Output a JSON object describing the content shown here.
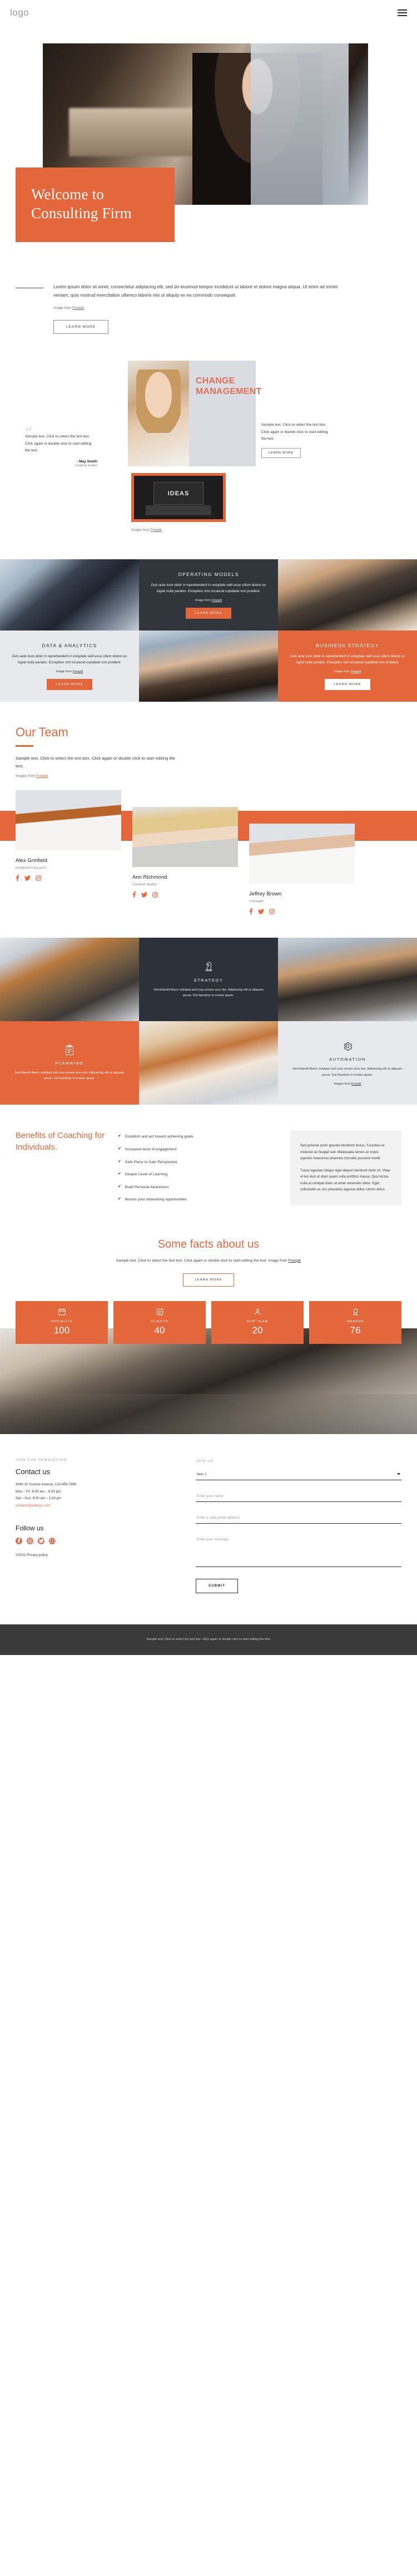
{
  "header": {
    "logo": "logo",
    "menu_icon": "hamburger-icon"
  },
  "hero": {
    "title_line1": "Welcome to",
    "title_line2": "Consulting Firm",
    "paragraph": "Lorem ipsum dolor sit amet, consectetur adipiscing elit, sed do eiusmod tempor incididunt ut labore et dolore magna aliqua. Ut enim ad minim veniam, quis nostrud exercitation ullamco laboris nisi ut aliquip ex ea commodo consequat.",
    "credit_prefix": "Image from ",
    "credit_link": "Freepik",
    "cta": "LEARN MORE"
  },
  "change": {
    "title_line1": "CHANGE",
    "title_line2": "MANAGEMENT",
    "right_text": "Sample text. Click to select the text box. Click again or double click to start editing the text.",
    "right_cta": "LEARN MORE",
    "quote_text": "Sample text. Click to select the text box. Click again or double click to start editing the text.",
    "quote_author": "- May Smith",
    "quote_role": "creative leader",
    "ideas_word": "IDEAS",
    "credit_prefix": "Images from ",
    "credit_link": "Freepik"
  },
  "services": [
    {
      "kind": "photo",
      "name": "two-businessmen-photo"
    },
    {
      "kind": "dark",
      "title": "OPERATING MODELS",
      "text": "Duis aute irure dolor in reprehenderit in voluptate velit esse cillum dolore eu fugiat nulla pariatur. Excepteur sint occaecat cupidatat non proident.",
      "credit_prefix": "Image from ",
      "credit_link": "Freepik",
      "cta": "LEARN MORE"
    },
    {
      "kind": "photo",
      "name": "smiling-man-coffee-photo"
    },
    {
      "kind": "light",
      "title": "DATA & ANALYTICS",
      "text": "Duis aute irure dolor in reprehenderit in voluptate velit esse cillum dolore eu fugiat nulla pariatur. Excepteur sint occaecat cupidatat non proident.",
      "credit_prefix": "Image from ",
      "credit_link": "Freepik",
      "cta": "LEARN MORE"
    },
    {
      "kind": "photo",
      "name": "bearded-man-glasses-photo"
    },
    {
      "kind": "orange",
      "title": "BUSINESS STRATEGY",
      "text": "Duis aute irure dolor in reprehenderit in voluptate velit esse cillum dolore eu fugiat nulla pariatur. Excepteur sint occaecat cupidatat non proident.",
      "credit_prefix": "Image from ",
      "credit_link": "Freepik",
      "cta": "LEARN MORE"
    }
  ],
  "team": {
    "heading": "Our Team",
    "subtext": "Sample text. Click to select the text box. Click again or double click to start editing the text.",
    "credit_prefix": "Images from ",
    "credit_link": "Freepik",
    "members": [
      {
        "name": "Alex Grinfield",
        "role": "programming guru"
      },
      {
        "name": "Ann Richmond",
        "role": "creative leader"
      },
      {
        "name": "Jeffrey Brown",
        "role": "manager"
      }
    ],
    "social_icons": [
      "facebook-icon",
      "twitter-icon",
      "instagram-icon"
    ]
  },
  "features": [
    {
      "kind": "photo",
      "name": "businesswoman-photo"
    },
    {
      "kind": "dark",
      "icon": "chess-knight-icon",
      "title": "STRATEGY",
      "text": "Sed blandit libero volutpat sed cras ornare arcu dui. Adipiscing elit ut aliquam purus. Dui faucibus in ornare quam."
    },
    {
      "kind": "photo",
      "name": "bearded-man-blue-shirt-photo"
    },
    {
      "kind": "orange",
      "icon": "clipboard-icon",
      "title": "PLANNING",
      "text": "Sed blandit libero volutpat sed cras ornare arcu dui. Adipiscing elit ut aliquam purus. Dui faucibus in ornare quam.",
      "credit_prefix": "",
      "credit_link": ""
    },
    {
      "kind": "photo",
      "name": "redhead-woman-photo"
    },
    {
      "kind": "grey",
      "icon": "gear-icon",
      "title": "AUTOMATION",
      "text": "Sed blandit libero volutpat sed cras ornare arcu dui. Adipiscing elit ut aliquam purus. Dui faucibus in ornare quam.",
      "credit_prefix": "Images from ",
      "credit_link": "Freepik"
    }
  ],
  "benefits": {
    "heading": "Benefits of Coaching for Individuals.",
    "items": [
      "Establish and act toward achieving goals",
      "Increased level of engagement",
      "Safe Place to Gain Perspective",
      "Deeper Level of Learning",
      "Build Personal Awareness",
      "Boosts your networking opportunities"
    ],
    "aside_p1": "Sed pulvinar proin gravida hendrerit lectus. Faucibus et molestie ac feugiat sed. Malesuada fames ac turpis egestas maecenas pharetra convallis posuere morbi.",
    "aside_p2": "Turpis egestas integer eget aliquet hendrerit dolor sit. Vitae et leo duis ut diam quam nulla porttitor massa. Quis lectus nulla at volutpat diam sit amet venenatis tellus. Eget sollicitudin ac orci phasellus egestas tellus rutrum tellus."
  },
  "facts": {
    "heading": "Some facts about us",
    "subtext": "Sample text. Click to select the text box. Click again or double click to start editing the text. Image from ",
    "subtext_link": "Freepik",
    "cta": "LEARN MORE",
    "counters": [
      {
        "icon": "projects-icon",
        "label": "PROJECTS",
        "value": "100"
      },
      {
        "icon": "clients-icon",
        "label": "CLIENTS",
        "value": "40"
      },
      {
        "icon": "team-icon",
        "label": "OUR TEAM",
        "value": "20"
      },
      {
        "icon": "awards-icon",
        "label": "AWARDS",
        "value": "76"
      }
    ]
  },
  "contact": {
    "eyebrow": "JOIN OUR NEWSLETTER",
    "heading": "Contact us",
    "address": "3040 10 Sunrise Avenue, 123-456-7890",
    "phone": "Mon – Fri: 9:00 am – 6:00 pm,",
    "hours": "Sat – Sun: 9:00 am – 1:00 pm",
    "email": "contacts@esbnyc.com",
    "follow_heading": "Follow us",
    "social_icons": [
      "facebook-icon",
      "instagram-icon",
      "twitter-icon",
      "youtube-icon"
    ],
    "copyright": "©2021 Privacy policy",
    "form": {
      "eyebrow": "JOIN US",
      "select_value": "Item 1",
      "name_placeholder": "Enter your name",
      "email_placeholder": "Enter a valid email address",
      "message_placeholder": "Enter your message",
      "submit": "SUBMIT"
    }
  },
  "bottombar": {
    "text": "Sample text. Click to select the text box. Click again or double click to start editing the text."
  }
}
